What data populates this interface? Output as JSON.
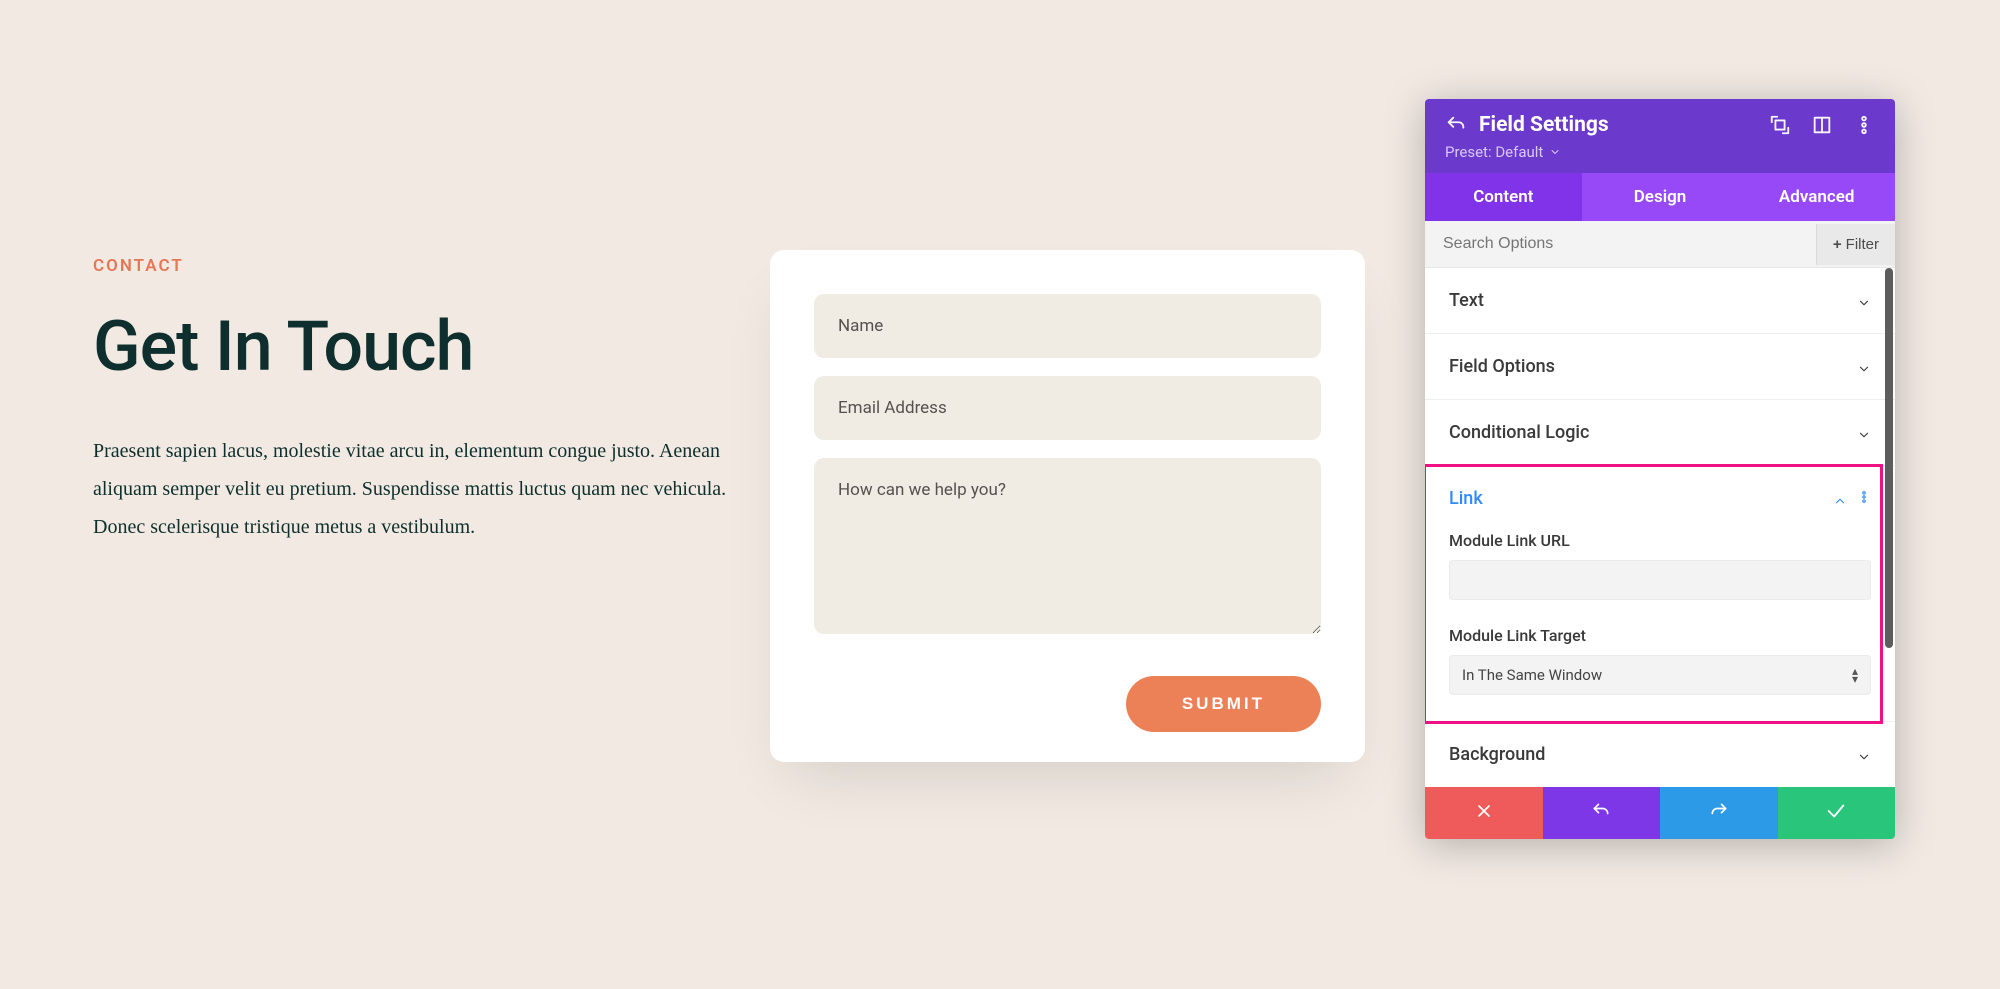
{
  "page": {
    "eyebrow": "CONTACT",
    "headline": "Get In Touch",
    "body": "Praesent sapien lacus, molestie vitae arcu in, elementum congue justo. Aenean aliquam semper velit eu pretium. Suspendisse mattis luctus quam nec vehicula. Donec scelerisque tristique metus a vestibulum."
  },
  "form": {
    "name_placeholder": "Name",
    "email_placeholder": "Email Address",
    "message_placeholder": "How can we help you?",
    "submit_label": "SUBMIT"
  },
  "panel": {
    "title": "Field Settings",
    "preset_label": "Preset: Default",
    "tabs": {
      "content": "Content",
      "design": "Design",
      "advanced": "Advanced",
      "active": "content"
    },
    "search_placeholder": "Search Options",
    "filter_label": "Filter",
    "sections": {
      "text": "Text",
      "field_options": "Field Options",
      "conditional_logic": "Conditional Logic",
      "link": "Link",
      "background": "Background"
    },
    "link": {
      "url_label": "Module Link URL",
      "url_value": "",
      "target_label": "Module Link Target",
      "target_value": "In The Same Window"
    }
  }
}
